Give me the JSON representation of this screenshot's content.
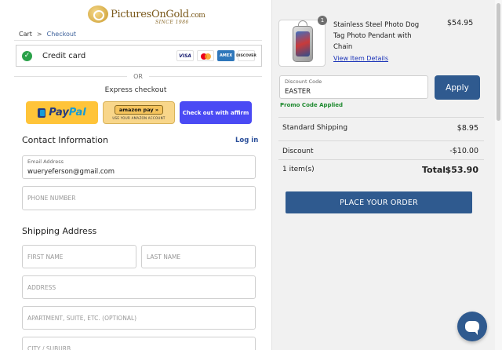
{
  "brand": {
    "name_main": "PicturesOnGold",
    "name_suffix": ".com",
    "since": "SINCE 1986"
  },
  "breadcrumb": {
    "cart": "Cart",
    "separator": ">",
    "checkout": "Checkout"
  },
  "payment": {
    "method_label": "Credit card",
    "cards": [
      "VISA",
      "mastercard",
      "AMEX",
      "DISCOVER"
    ],
    "or": "OR",
    "express_label": "Express checkout",
    "paypal_a": "Pay",
    "paypal_b": "Pal",
    "amazon_label": "amazon pay »",
    "amazon_sub": "USE YOUR AMAZON ACCOUNT",
    "affirm_label": "Check out with affirm"
  },
  "contact": {
    "title": "Contact Information",
    "login": "Log in",
    "email_label": "Email Address",
    "email_value": "wueryeferson@gmail.com",
    "phone_placeholder": "PHONE NUMBER"
  },
  "shipping": {
    "title": "Shipping Address",
    "first_name_placeholder": "FIRST NAME",
    "last_name_placeholder": "LAST NAME",
    "address_placeholder": "ADDRESS",
    "apt_placeholder": "APARTMENT, SUITE, ETC. (OPTIONAL)",
    "city_placeholder": "CITY / SUBURB"
  },
  "cart_item": {
    "quantity": "1",
    "name": "Stainless Steel Photo Dog Tag Photo Pendant with Chain",
    "price": "$54.95",
    "view_link": "View Item Details"
  },
  "discount": {
    "label": "Discount Code",
    "value": "EASTER",
    "apply": "Apply",
    "promo_status": "Promo Code Applied"
  },
  "summary": {
    "shipping_label": "Standard Shipping",
    "shipping_value": "$8.95",
    "discount_label": "Discount",
    "discount_value": "-$10.00",
    "items_label": "1 item(s)",
    "total_label": "Total",
    "total_value": "$53.90"
  },
  "place_order": "PLACE YOUR ORDER",
  "colors": {
    "primary": "#2f5a8f",
    "paypal": "#ffc439",
    "affirm": "#4a4af4",
    "success": "#2aa149",
    "link": "#1a33b8"
  },
  "icons": {
    "chat": "chat-bubble-icon",
    "check": "check-circle-icon"
  }
}
